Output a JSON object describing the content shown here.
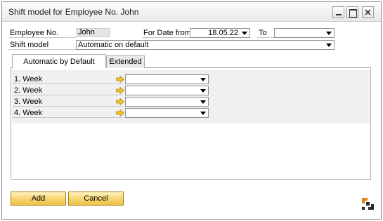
{
  "window": {
    "title": "Shift model for Employee No. John",
    "minimize_icon": "minimize-icon",
    "maximize_icon": "maximize-icon",
    "close_icon": "close-icon"
  },
  "header": {
    "employee_label": "Employee No.",
    "employee_value": "John",
    "for_date_label": "For Date from",
    "for_date_value": "18.05.22",
    "to_label": "To",
    "to_value": "",
    "shift_model_label": "Shift model",
    "shift_model_value": "Automatic on default"
  },
  "tabs": [
    {
      "label": "Automatic by Default",
      "active": true
    },
    {
      "label": "Extended",
      "active": false
    }
  ],
  "weeks": [
    {
      "label": "1. Week",
      "value": ""
    },
    {
      "label": "2. Week",
      "value": ""
    },
    {
      "label": "3. Week",
      "value": ""
    },
    {
      "label": "4. Week",
      "value": ""
    }
  ],
  "buttons": {
    "add_label": "Add",
    "cancel_label": "Cancel"
  },
  "colors": {
    "button_fill": "#f6d36b",
    "button_border": "#a57f12",
    "link_arrow": "#f4c430",
    "brand_orange": "#e8801a"
  }
}
